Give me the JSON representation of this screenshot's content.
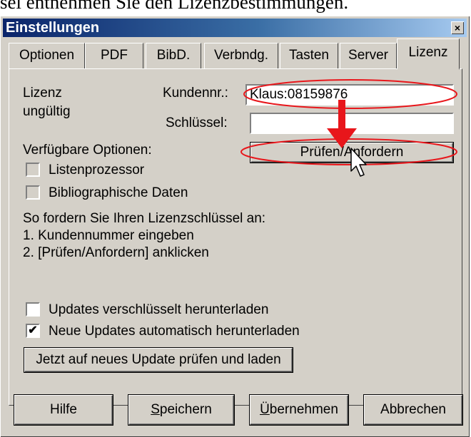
{
  "caption": "sel entnehmen Sie den Lizenzbestimmungen.",
  "window": {
    "title": "Einstellungen",
    "close_symbol": "×"
  },
  "tabs": [
    {
      "label": "Optionen"
    },
    {
      "label": "PDF"
    },
    {
      "label": "BibD."
    },
    {
      "label": "Verbndg."
    },
    {
      "label": "Tasten"
    },
    {
      "label": "Server"
    },
    {
      "label": "Lizenz",
      "active": true
    }
  ],
  "license": {
    "status_line1": "Lizenz",
    "status_line2": "ungültig",
    "customer_label": "Kundennr.:",
    "customer_value": "Klaus:08159876",
    "key_label": "Schlüssel:",
    "key_value": "",
    "check_button": "Prüfen/Anfordern"
  },
  "options": {
    "heading": "Verfügbare Optionen:",
    "items": [
      {
        "label": "Listenprozessor",
        "checked": false
      },
      {
        "label": "Bibliographische Daten",
        "checked": false
      }
    ]
  },
  "instructions": {
    "line1": "So fordern Sie Ihren Lizenzschlüssel an:",
    "line2": "1. Kundennummer eingeben",
    "line3": "2. [Prüfen/Anfordern] anklicken"
  },
  "updates": {
    "encrypted": {
      "label": "Updates verschlüsselt herunterladen",
      "checked": false
    },
    "auto": {
      "label": "Neue Updates automatisch herunterladen",
      "checked": true,
      "mark": "✔"
    },
    "check_button": "Jetzt auf neues Update prüfen und laden"
  },
  "footer": {
    "help": "Hilfe",
    "save_first": "S",
    "save_rest": "peichern",
    "apply_first": "Ü",
    "apply_rest": "bernehmen",
    "cancel": "Abbrechen"
  },
  "colors": {
    "annotation_red": "#e8161b",
    "face": "#d4d0c8",
    "title_start": "#0a246a"
  },
  "icons": [
    "close-icon",
    "arrow-down-annotation",
    "mouse-cursor-icon"
  ]
}
